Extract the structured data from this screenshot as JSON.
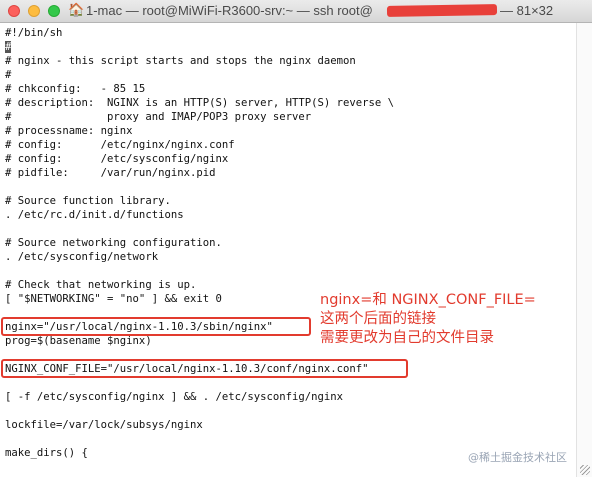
{
  "window": {
    "title_prefix": "1-mac — root@MiWiFi-R3600-srv:~ — ssh root@",
    "title_size": "— 81×32",
    "home_icon": "🏠"
  },
  "terminal_lines": [
    {
      "text": "#!/bin/sh"
    },
    {
      "text": "#"
    },
    {
      "text": "# nginx - this script starts and stops the nginx daemon"
    },
    {
      "text": "#"
    },
    {
      "text": "# chkconfig:   - 85 15"
    },
    {
      "text": "# description:  NGINX is an HTTP(S) server, HTTP(S) reverse \\"
    },
    {
      "text": "#               proxy and IMAP/POP3 proxy server"
    },
    {
      "text": "# processname: nginx"
    },
    {
      "text": "# config:      /etc/nginx/nginx.conf"
    },
    {
      "text": "# config:      /etc/sysconfig/nginx"
    },
    {
      "text": "# pidfile:     /var/run/nginx.pid"
    },
    {
      "text": ""
    },
    {
      "text": "# Source function library."
    },
    {
      "text": ". /etc/rc.d/init.d/functions"
    },
    {
      "text": ""
    },
    {
      "text": "# Source networking configuration."
    },
    {
      "text": ". /etc/sysconfig/network"
    },
    {
      "text": ""
    },
    {
      "text": "# Check that networking is up."
    },
    {
      "text": "[ \"$NETWORKING\" = \"no\" ] && exit 0"
    },
    {
      "text": ""
    },
    {
      "text": "nginx=\"/usr/local/nginx-1.10.3/sbin/nginx\""
    },
    {
      "text": "prog=$(basename $nginx)"
    },
    {
      "text": ""
    },
    {
      "text": "NGINX_CONF_FILE=\"/usr/local/nginx-1.10.3/conf/nginx.conf\""
    },
    {
      "text": ""
    },
    {
      "text": "[ -f /etc/sysconfig/nginx ] && . /etc/sysconfig/nginx"
    },
    {
      "text": ""
    },
    {
      "text": "lockfile=/var/lock/subsys/nginx"
    },
    {
      "text": ""
    },
    {
      "text": "make_dirs() {"
    }
  ],
  "annotation": {
    "line1": "nginx=和 NGINX_CONF_FILE=",
    "line2": "这两个后面的链接",
    "line3": "需要更改为自己的文件目录"
  },
  "watermark": "@稀土掘金技术社区",
  "colors": {
    "annotation": "#e23b2e",
    "redaction": "#e8403a"
  }
}
